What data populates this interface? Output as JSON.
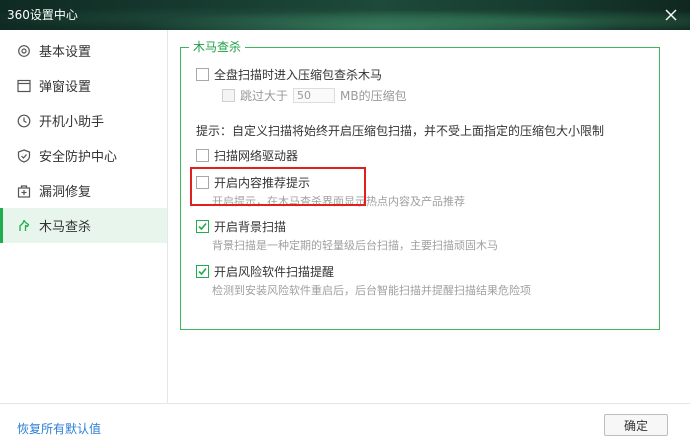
{
  "window": {
    "title": "360设置中心"
  },
  "sidebar": {
    "items": [
      {
        "label": "基本设置",
        "icon": "gear-icon"
      },
      {
        "label": "弹窗设置",
        "icon": "window-icon"
      },
      {
        "label": "开机小助手",
        "icon": "clock-icon"
      },
      {
        "label": "安全防护中心",
        "icon": "shield-icon"
      },
      {
        "label": "漏洞修复",
        "icon": "patch-icon"
      },
      {
        "label": "木马查杀",
        "icon": "horse-icon",
        "active": true
      }
    ]
  },
  "group": {
    "title": "木马查杀",
    "scan_compressed": {
      "label": "全盘扫描时进入压缩包查杀木马",
      "checked": false
    },
    "skip_larger": {
      "prefix": "跳过大于",
      "value": "50",
      "suffix": "MB的压缩包",
      "checked": false,
      "disabled": true
    },
    "tip": "提示：自定义扫描将始终开启压缩包扫描，并不受上面指定的压缩包大小限制",
    "scan_network_driver": {
      "label": "扫描网络驱动器",
      "checked": false
    },
    "content_recommend": {
      "label": "开启内容推荐提示",
      "desc": "开启提示，在木马查杀界面显示热点内容及产品推荐",
      "checked": false
    },
    "background_scan": {
      "label": "开启背景扫描",
      "desc": "背景扫描是一种定期的轻量级后台扫描，主要扫描顽固木马",
      "checked": true
    },
    "risk_software": {
      "label": "开启风险软件扫描提醒",
      "desc": "检测到安装风险软件重启后，后台智能扫描并提醒扫描结果危险项",
      "checked": true
    }
  },
  "footer": {
    "restore_label": "恢复所有默认值",
    "ok_label": "确定"
  },
  "colors": {
    "accent": "#1fae4b",
    "highlight": "#e21f1f",
    "link": "#2c7fd6"
  }
}
